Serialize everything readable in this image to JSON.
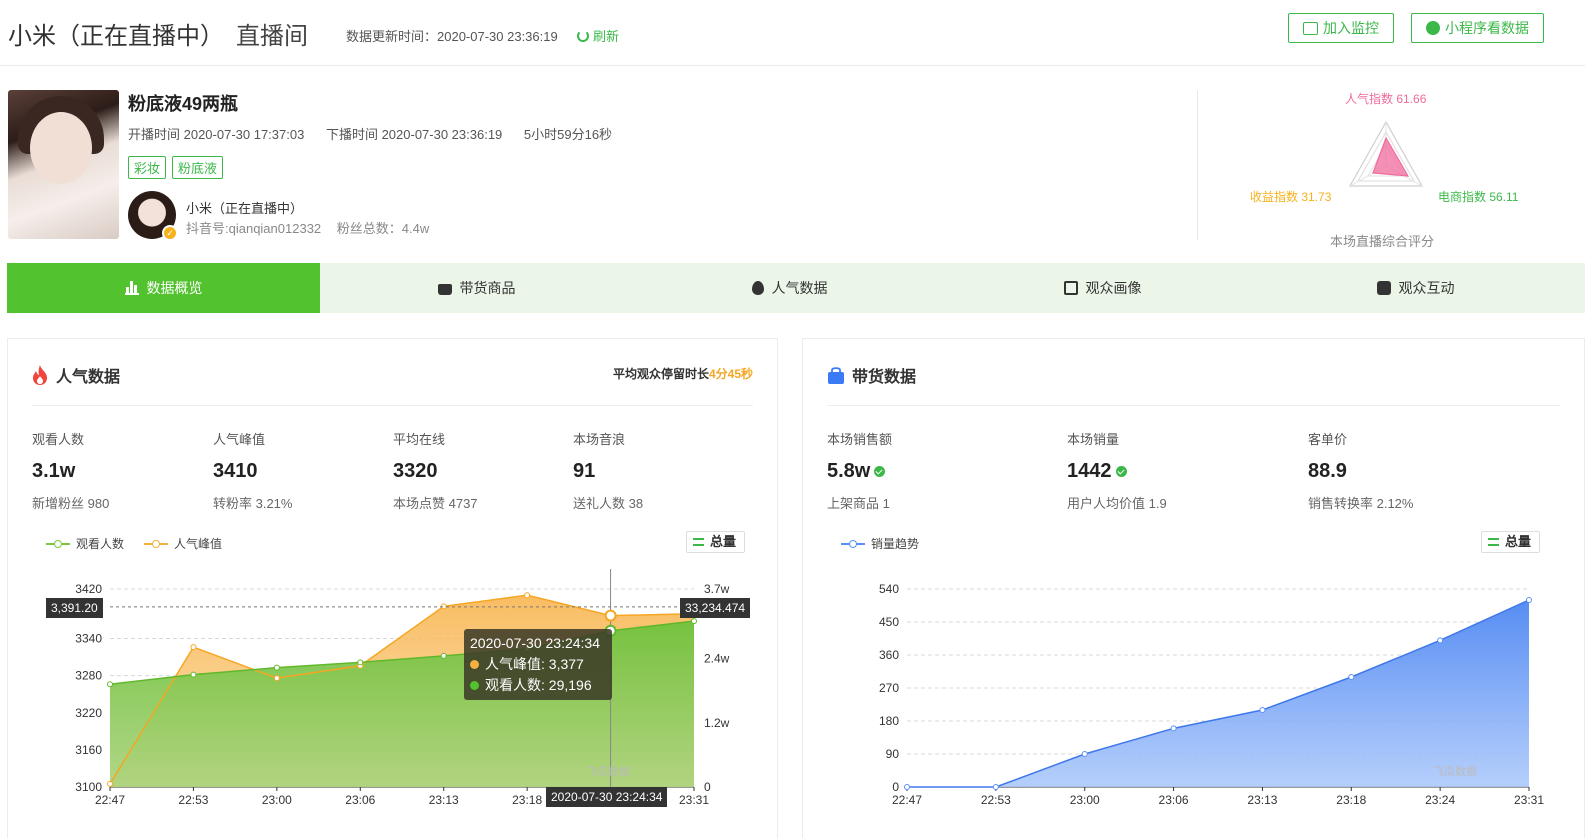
{
  "header": {
    "title": "小米（正在直播中）",
    "room_label": "直播间",
    "update_time": "数据更新时间：2020-07-30 23:36:19",
    "refresh_label": "刷新",
    "add_monitor_label": "加入监控",
    "mini_program_label": "小程序看数据"
  },
  "live": {
    "product_title": "粉底液49两瓶",
    "start_time": "开播时间 2020-07-30 17:37:03",
    "end_time": "下播时间 2020-07-30 23:36:19",
    "duration": "5小时59分16秒",
    "tags": [
      "彩妆",
      "粉底液"
    ],
    "anchor_name": "小米（正在直播中）",
    "douyin_id": "抖音号:qianqian012332",
    "fans_total": "粉丝总数：4.4w"
  },
  "scores": {
    "popularity": "人气指数 61.66",
    "revenue": "收益指数 31.73",
    "ecommerce": "电商指数 56.11",
    "title": "本场直播综合评分",
    "values": {
      "popularity": 61.66,
      "revenue": 31.73,
      "ecommerce": 56.11
    },
    "colors": {
      "popularity": "#f06b9c",
      "revenue": "#f5b21b",
      "ecommerce": "#3cb84a"
    }
  },
  "tabs": [
    "数据概览",
    "带货商品",
    "人气数据",
    "观众画像",
    "观众互动"
  ],
  "popularity": {
    "title": "人气数据",
    "avg_stay_label": "平均观众停留时长",
    "avg_stay_value": "4分45秒",
    "stats": [
      {
        "label": "观看人数",
        "value": "3.1w",
        "sub": "新增粉丝 980"
      },
      {
        "label": "人气峰值",
        "value": "3410",
        "sub": "转粉率 3.21%"
      },
      {
        "label": "平均在线",
        "value": "3320",
        "sub": "本场点赞 4737"
      },
      {
        "label": "本场音浪",
        "value": "91",
        "sub": "送礼人数 38"
      }
    ],
    "legend": [
      "观看人数",
      "人气峰值"
    ],
    "total_btn": "总量",
    "tooltip": {
      "time": "2020-07-30 23:24:34",
      "peak_line": "人气峰值: 3,377",
      "viewers_line": "观看人数: 29,196"
    },
    "crosshair_left_tag": "3,391.20",
    "crosshair_right_tag": "33,234.474",
    "crosshair_bottom_tag": "2020-07-30 23:24:34",
    "watermark": "飞瓜数据"
  },
  "sales": {
    "title": "带货数据",
    "stats": [
      {
        "label": "本场销售额",
        "value": "5.8w",
        "sub": "上架商品 1"
      },
      {
        "label": "本场销量",
        "value": "1442",
        "sub": "用户人均价值 1.9"
      },
      {
        "label": "客单价",
        "value": "88.9",
        "sub": "销售转换率 2.12%"
      }
    ],
    "legend": [
      "销量趋势"
    ],
    "total_btn": "总量",
    "watermark": "飞瓜数据"
  },
  "chart_data": [
    {
      "type": "area",
      "x": [
        "22:47",
        "22:53",
        "23:00",
        "23:06",
        "23:13",
        "23:18",
        "23:24",
        "23:31"
      ],
      "series": [
        {
          "name": "观看人数",
          "axis": "right",
          "color": "#7cc940",
          "values": [
            19200,
            21000,
            22300,
            23300,
            24500,
            25800,
            29196,
            31000
          ]
        },
        {
          "name": "人气峰值",
          "axis": "left",
          "color": "#f5b041",
          "values": [
            3105,
            3326,
            3276,
            3296,
            3392,
            3410,
            3377,
            3380
          ]
        }
      ],
      "y_left": {
        "ticks": [
          3100,
          3160,
          3220,
          3280,
          3340,
          3420
        ],
        "ylim": [
          3100,
          3420
        ]
      },
      "y_right": {
        "ticks": [
          "0",
          "1.2w",
          "2.4w",
          "3.7w"
        ],
        "ylim": [
          0,
          37000
        ]
      },
      "grid": true
    },
    {
      "type": "area",
      "x": [
        "22:47",
        "22:53",
        "23:00",
        "23:06",
        "23:13",
        "23:18",
        "23:24",
        "23:31"
      ],
      "series": [
        {
          "name": "销量趋势",
          "color": "#5b8ff9",
          "values": [
            0,
            0,
            90,
            160,
            210,
            300,
            400,
            510
          ]
        }
      ],
      "y": {
        "ticks": [
          0,
          90,
          180,
          270,
          360,
          450,
          540
        ],
        "ylim": [
          0,
          540
        ]
      },
      "grid": true
    }
  ]
}
